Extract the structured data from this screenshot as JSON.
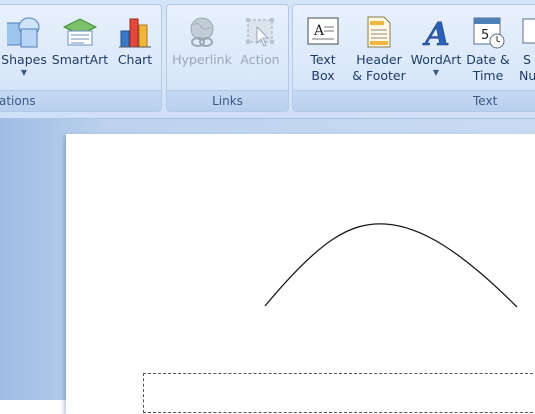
{
  "ribbon": {
    "illustrations": {
      "label": "ations",
      "shapes": {
        "label": "Shapes",
        "icon": "shapes-icon"
      },
      "smartart": {
        "label": "SmartArt",
        "icon": "smartart-icon"
      },
      "chart": {
        "label": "Chart",
        "icon": "chart-icon"
      }
    },
    "links": {
      "label": "Links",
      "hyperlink": {
        "label": "Hyperlink",
        "icon": "hyperlink-globe-icon"
      },
      "action": {
        "label": "Action",
        "icon": "action-icon"
      }
    },
    "text": {
      "label": "Text",
      "textbox": {
        "line1": "Text",
        "line2": "Box",
        "icon": "textbox-icon"
      },
      "header_footer": {
        "line1": "Header",
        "line2": "& Footer",
        "icon": "header-footer-icon"
      },
      "wordart": {
        "label": "WordArt",
        "icon": "wordart-icon"
      },
      "datetime": {
        "line1": "Date &",
        "line2": "Time",
        "icon": "calendar-clock-icon",
        "calendar_day": "5"
      },
      "slide_number": {
        "line1": "S",
        "line2": "Nu",
        "icon": "slide-number-icon"
      }
    }
  },
  "colors": {
    "ribbon_bg": "#d3e3f8",
    "label_text": "#1e3c66",
    "group_label_text": "#3b5a86",
    "disabled_text": "#9aa7b8",
    "slide_bg": "#ffffff"
  }
}
